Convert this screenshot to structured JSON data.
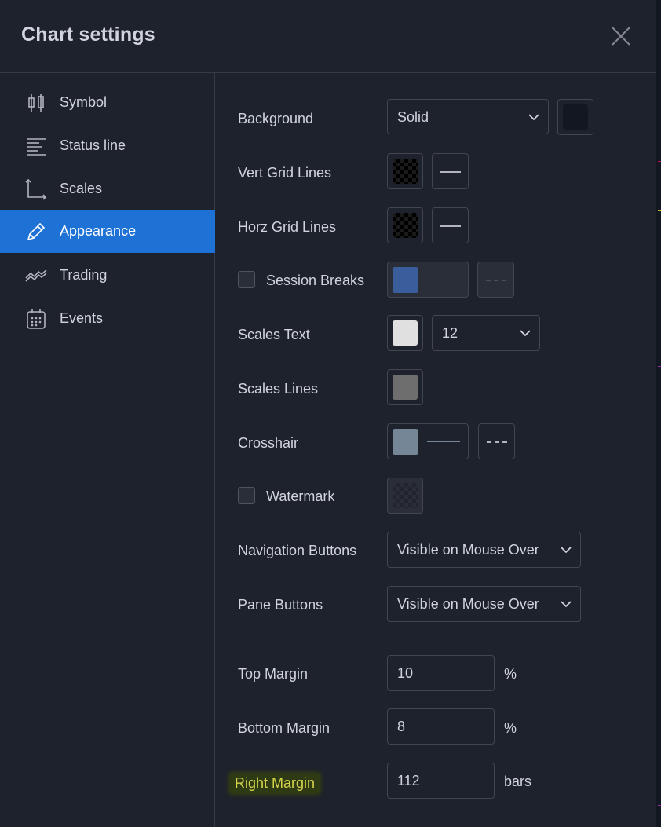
{
  "dialog": {
    "title": "Chart settings"
  },
  "sidebar": {
    "items": [
      {
        "label": "Symbol",
        "icon": "candlestick-icon"
      },
      {
        "label": "Status line",
        "icon": "status-line-icon"
      },
      {
        "label": "Scales",
        "icon": "scales-icon"
      },
      {
        "label": "Appearance",
        "icon": "pencil-icon",
        "active": true
      },
      {
        "label": "Trading",
        "icon": "trading-icon"
      },
      {
        "label": "Events",
        "icon": "calendar-icon"
      }
    ]
  },
  "appearance": {
    "background": {
      "label": "Background",
      "value": "Solid",
      "color": "#131722"
    },
    "vert_grid": {
      "label": "Vert Grid Lines"
    },
    "horz_grid": {
      "label": "Horz Grid Lines"
    },
    "session_breaks": {
      "label": "Session Breaks",
      "checked": false,
      "color": "#3a5d9c"
    },
    "scales_text": {
      "label": "Scales Text",
      "color": "#e0e0e0",
      "size": "12"
    },
    "scales_lines": {
      "label": "Scales Lines",
      "color": "#6e6e6e"
    },
    "crosshair": {
      "label": "Crosshair",
      "color": "#758696"
    },
    "watermark": {
      "label": "Watermark",
      "checked": false
    },
    "navigation_buttons": {
      "label": "Navigation Buttons",
      "value": "Visible on Mouse Over"
    },
    "pane_buttons": {
      "label": "Pane Buttons",
      "value": "Visible on Mouse Over"
    },
    "top_margin": {
      "label": "Top Margin",
      "value": "10",
      "unit": "%"
    },
    "bottom_margin": {
      "label": "Bottom Margin",
      "value": "8",
      "unit": "%"
    },
    "right_margin": {
      "label": "Right Margin",
      "value": "112",
      "unit": "bars"
    }
  },
  "colors": {
    "accent": "#1e72d6",
    "panel": "#1e222d",
    "border": "#363a45",
    "highlight_text": "#d6d44a"
  }
}
